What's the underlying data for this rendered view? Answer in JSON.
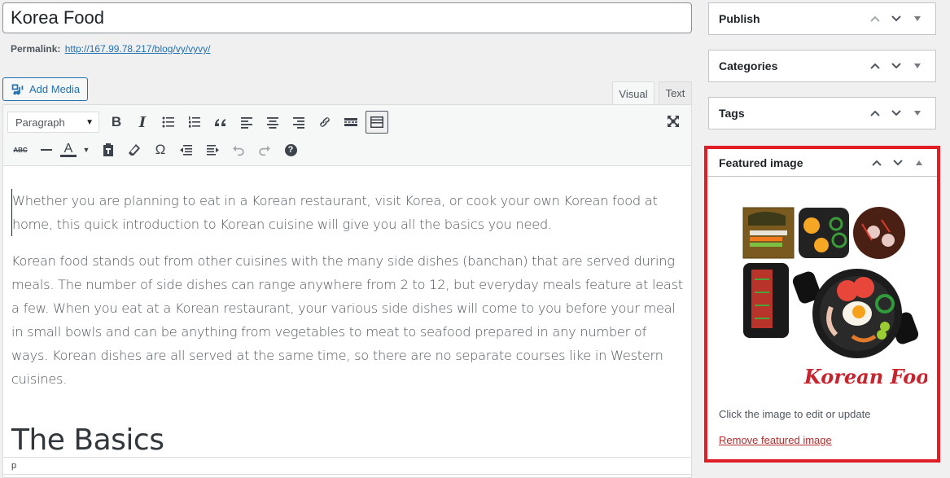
{
  "post": {
    "title": "Korea Food",
    "permalink_label": "Permalink:",
    "permalink_url": "http://167.99.78.217/blog/vy/vyvy/"
  },
  "editor": {
    "add_media_label": "Add Media",
    "tabs": [
      {
        "label": "Visual",
        "active": true
      },
      {
        "label": "Text",
        "active": false
      }
    ],
    "format_select": "Paragraph",
    "toolbar_row1": [
      "bold-icon",
      "italic-icon",
      "bullet-list-icon",
      "numbered-list-icon",
      "blockquote-icon",
      "align-left-icon",
      "align-center-icon",
      "align-right-icon",
      "link-icon",
      "read-more-icon",
      "toolbar-toggle-icon"
    ],
    "toolbar_row2": [
      "strikethrough-icon",
      "horizontal-line-icon",
      "text-color-icon",
      "paste-as-text-icon",
      "clear-formatting-icon",
      "special-character-icon",
      "outdent-icon",
      "indent-icon",
      "undo-icon",
      "redo-icon",
      "help-icon"
    ],
    "bold_glyph": "B",
    "italic_glyph": "I",
    "strike_glyph": "ABC",
    "color_glyph": "A",
    "omega_glyph": "Ω",
    "help_glyph": "?",
    "paragraphs": [
      "Whether you are planning to eat in a Korean restaurant, visit Korea, or cook your own Korean food at home, this quick introduction to Korean cuisine will give you all the basics you need.",
      "Korean food stands out from other cuisines with the many side dishes (banchan) that are served during meals. The number of side dishes can range anywhere from 2 to 12, but everyday meals feature at least a few. When you eat at a Korean restaurant, your various side dishes will come to you before your meal in small bowls and can be anything from vegetables to meat to seafood prepared in any number of ways. Korean dishes are all served at the same time, so there are no separate courses like in Western cuisines."
    ],
    "heading": "The Basics",
    "path": "p"
  },
  "sidebar": {
    "boxes": [
      {
        "title": "Publish"
      },
      {
        "title": "Categories"
      },
      {
        "title": "Tags"
      }
    ],
    "featured": {
      "title": "Featured image",
      "image_caption": "Korean Food",
      "help_text": "Click the image to edit or update",
      "remove_label": "Remove featured image"
    }
  },
  "colors": {
    "highlight_border": "#e01d24",
    "link": "#2271b1",
    "remove_link": "#b32d2e"
  }
}
